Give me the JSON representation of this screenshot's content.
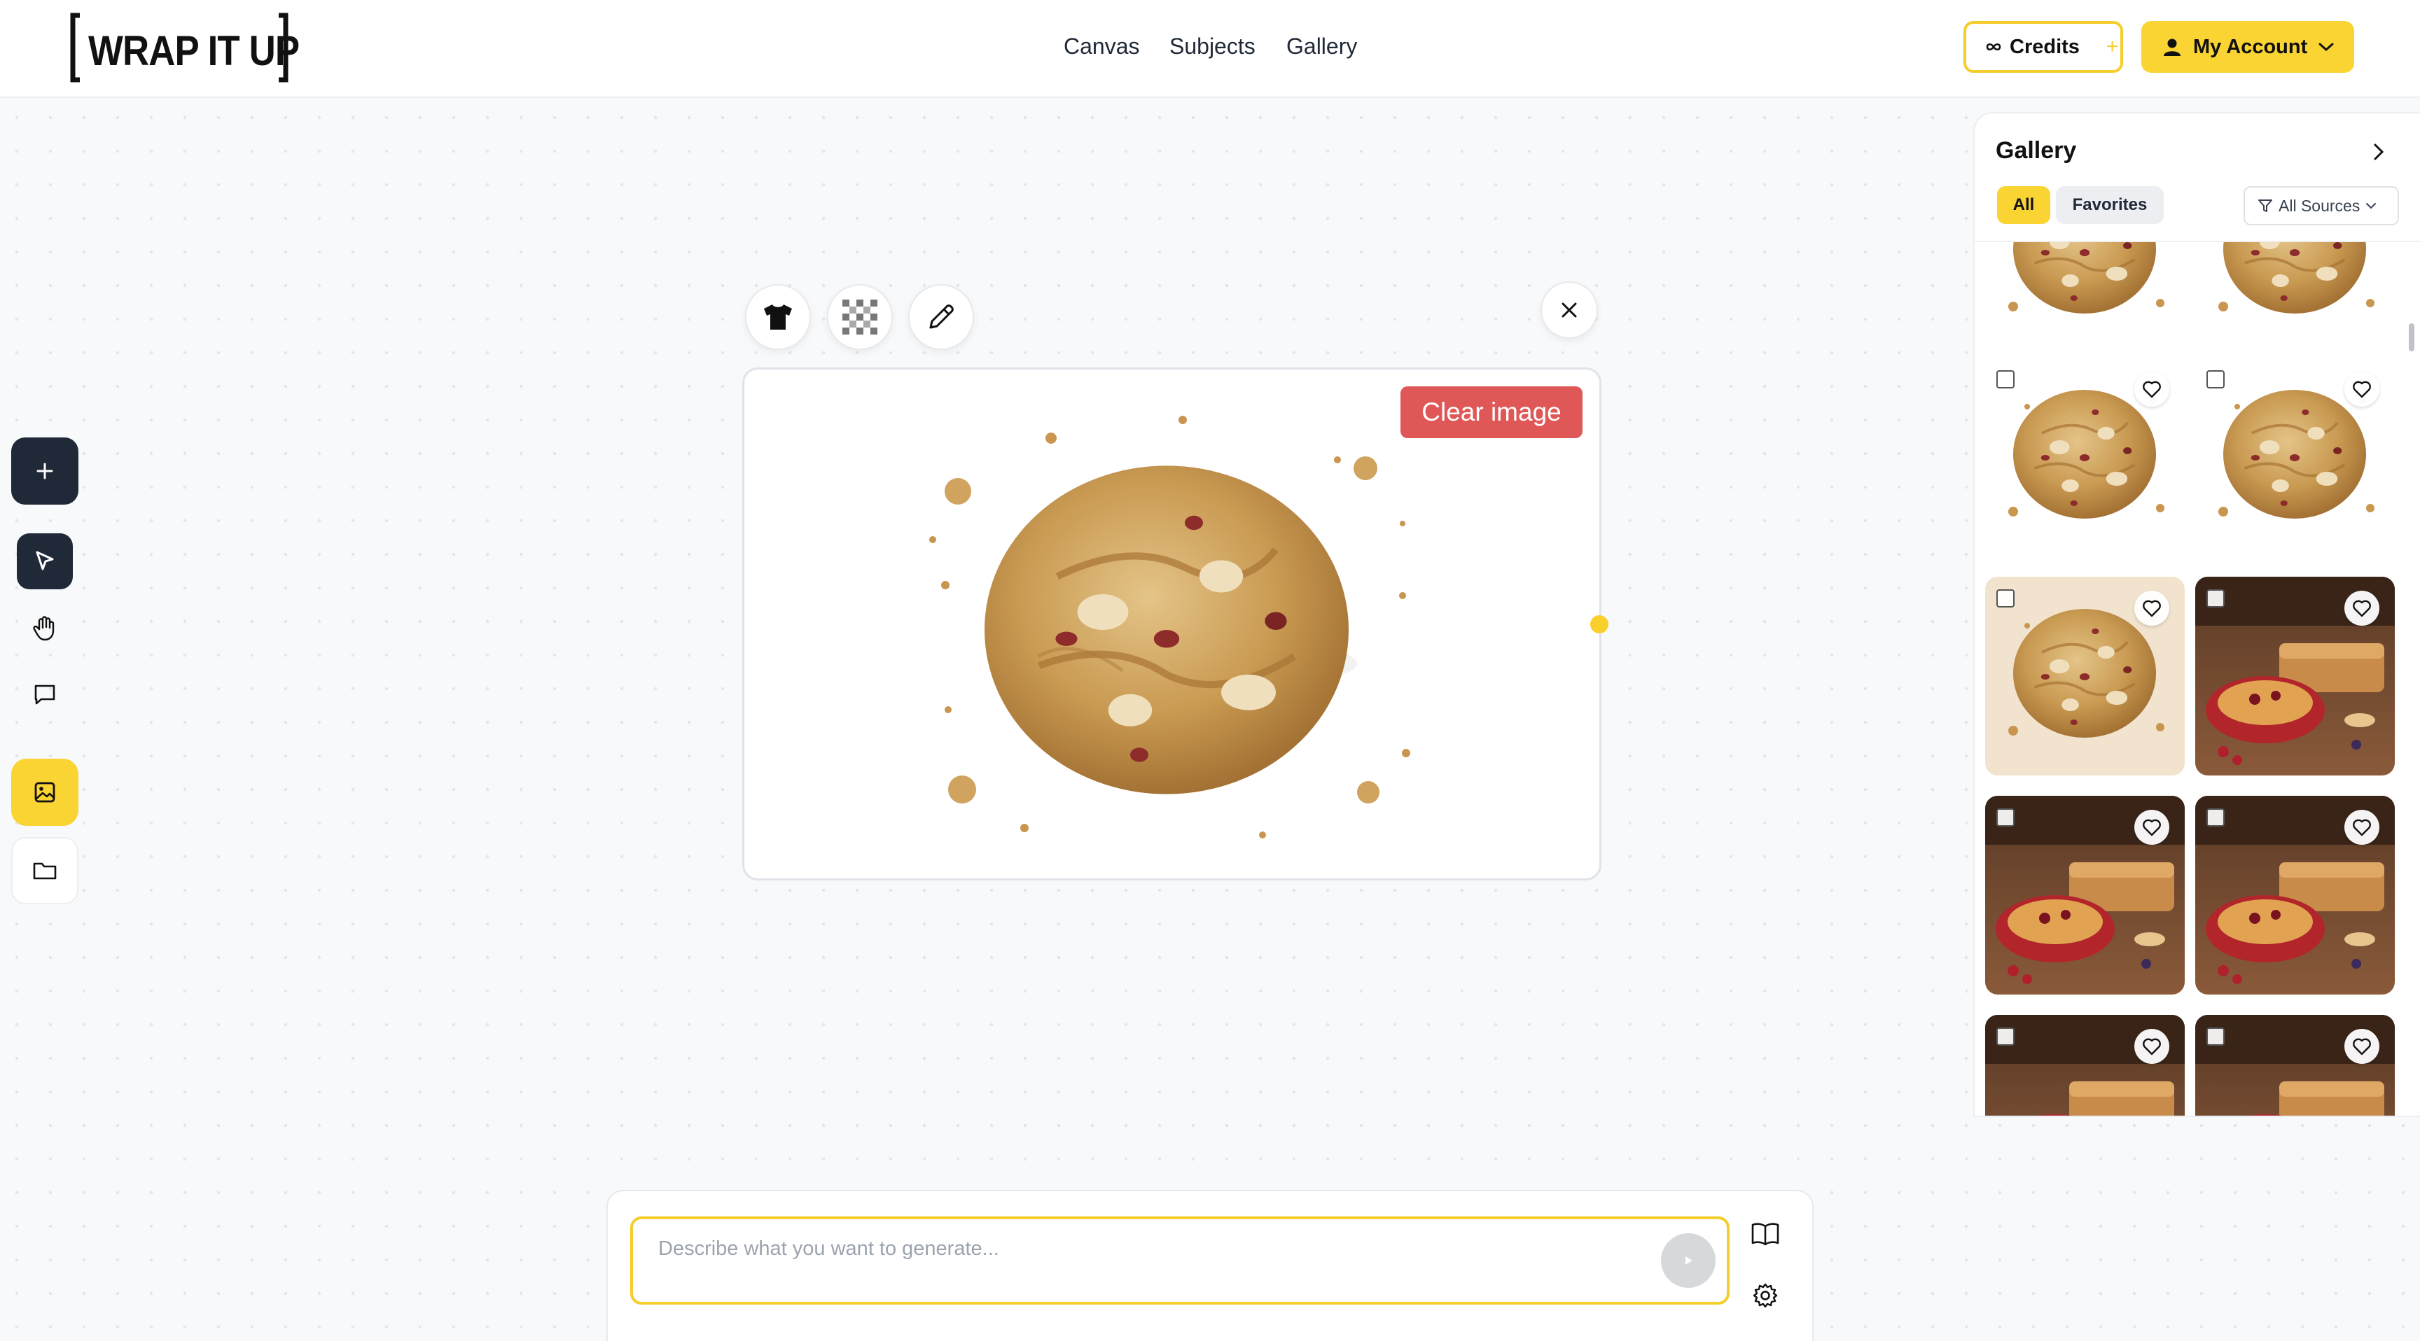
{
  "header": {
    "logo_text": "WRAP IT UP",
    "nav": [
      "Canvas",
      "Subjects",
      "Gallery"
    ],
    "credits_label": "Credits",
    "account_label": "My Account"
  },
  "left_toolbar": {
    "tools": [
      "add",
      "select",
      "pan",
      "comment",
      "image",
      "folder"
    ],
    "active": "image"
  },
  "canvas": {
    "clear_label": "Clear image",
    "image_subject": "cookie",
    "toolbar_icons": [
      "tshirt-icon",
      "transparency-icon",
      "pencil-icon"
    ]
  },
  "gallery": {
    "title": "Gallery",
    "filters": [
      "All",
      "Favorites"
    ],
    "active_filter": "All",
    "sources_label": "All Sources",
    "items": [
      {
        "kind": "cookie"
      },
      {
        "kind": "cookie"
      },
      {
        "kind": "cookie"
      },
      {
        "kind": "cookie"
      },
      {
        "kind": "cookie-beige"
      },
      {
        "kind": "dessert"
      },
      {
        "kind": "dessert"
      },
      {
        "kind": "dessert"
      },
      {
        "kind": "dessert"
      },
      {
        "kind": "dessert"
      }
    ]
  },
  "prompt": {
    "placeholder": "Describe what you want to generate..."
  },
  "colors": {
    "accent": "#f9d433",
    "dark": "#1f2937",
    "danger": "#e05757"
  }
}
